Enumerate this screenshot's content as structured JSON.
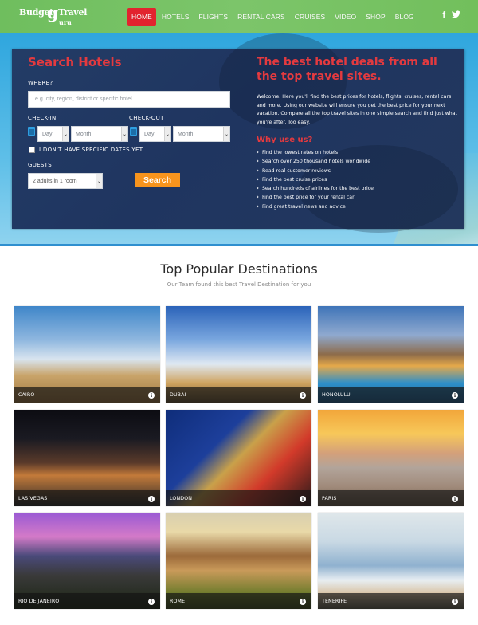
{
  "header": {
    "logo": {
      "line1": "Budget",
      "g": "g",
      "line2": "Travel",
      "line3": "uru"
    },
    "nav": [
      "HOME",
      "HOTELS",
      "FLIGHTS",
      "RENTAL CARS",
      "CRUISES",
      "VIDEO",
      "SHOP",
      "BLOG"
    ],
    "active_nav": "HOME",
    "social": {
      "facebook": "f",
      "twitter": "t"
    }
  },
  "search": {
    "title": "Search Hotels",
    "where_label": "WHERE?",
    "where_placeholder": "e.g. city, region, district or specific hotel",
    "checkin_label": "CHECK-IN",
    "checkout_label": "CHECK-OUT",
    "checkin_day": "Day",
    "checkin_month": "Month",
    "checkout_day": "Day",
    "checkout_month": "Month",
    "no_dates_label": "I DON'T HAVE SPECIFIC DATES YET",
    "guests_label": "GUESTS",
    "guests_value": "2 adults in 1 room",
    "search_button": "Search"
  },
  "deals": {
    "title": "The best hotel deals from all the top travel sites.",
    "text": "Welcome. Here you'll find the best prices for hotels, flights, cruises, rental cars and more. Using our website will ensure you get the best price for your next vacation. Compare all the top travel sites in one simple search and find just what you're after. Too easy.",
    "why_title": "Why use us?",
    "why_items": [
      "Find the lowest rates on hotels",
      "Search over 250 thousand hotels worldwide",
      "Read real customer reviews",
      "Find the best cruise prices",
      "Search hundreds of airlines for the best price",
      "Find the best price for your rental car",
      "Find great travel news and advice"
    ]
  },
  "destinations": {
    "title": "Top Popular Destinations",
    "subtitle": "Our Team found this best Travel Destination for you",
    "items": [
      "CAIRO",
      "DUBAI",
      "HONOLULU",
      "LAS VEGAS",
      "LONDON",
      "PARIS",
      "RIO DE JANEIRO",
      "ROME",
      "TENERIFE"
    ],
    "info_glyph": "i"
  },
  "colors": {
    "header_green": "#72bf5c",
    "nav_active": "#e2232e",
    "accent_red": "#e43a3f",
    "panel_navy": "#223a64",
    "search_orange": "#f7941d",
    "calendar_blue": "#2f9ee0"
  }
}
